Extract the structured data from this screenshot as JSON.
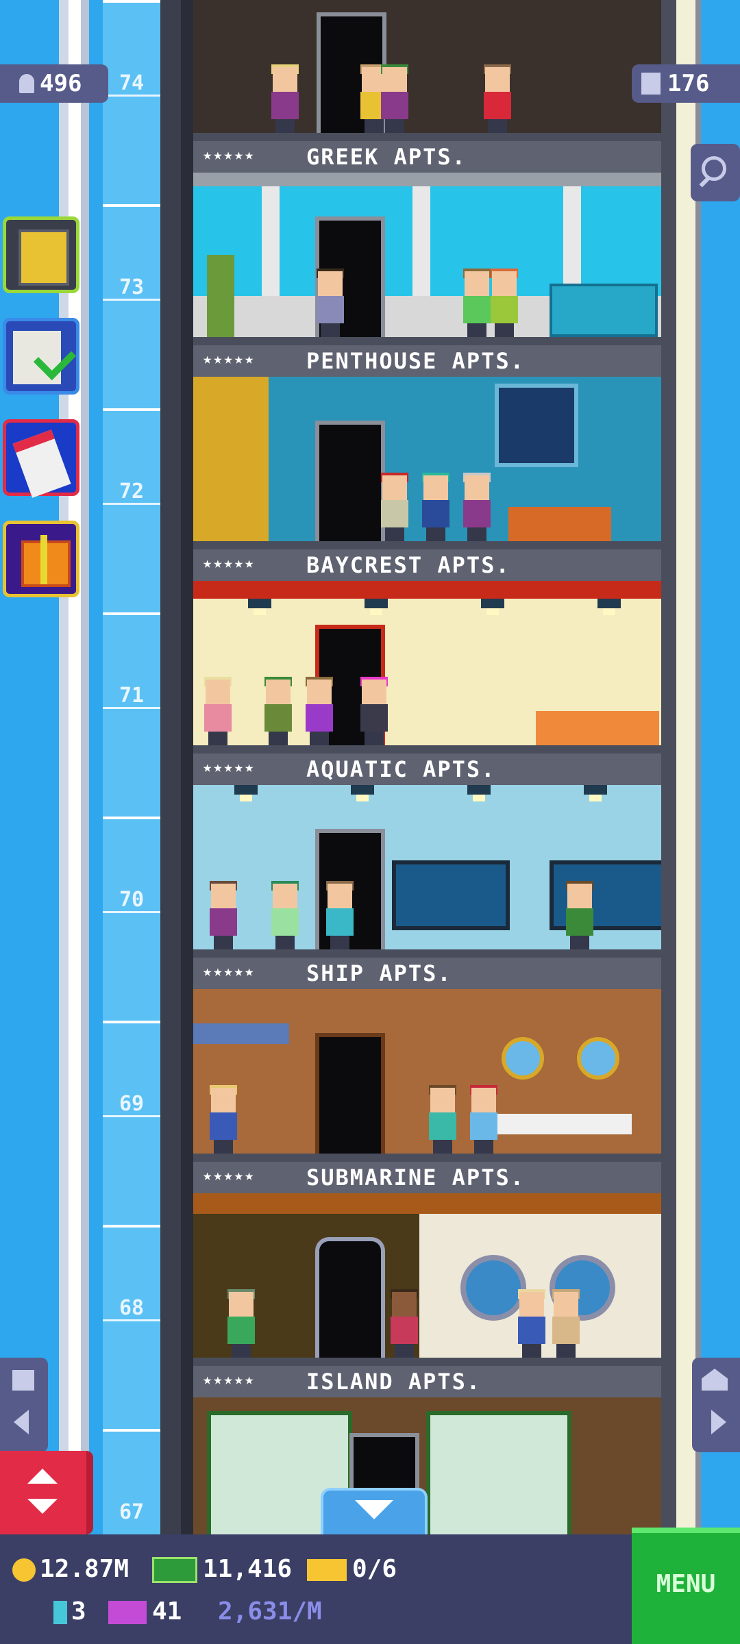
{
  "hud_top": {
    "population": "496",
    "population_icon": "person-icon",
    "floors_count": "176",
    "floors_icon": "building-icon"
  },
  "floor_numbers": [
    "74",
    "73",
    "72",
    "71",
    "70",
    "69",
    "68",
    "67"
  ],
  "floors": [
    {
      "name": "GREEK APTS.",
      "stars": "★★★★★"
    },
    {
      "name": "PENTHOUSE APTS.",
      "stars": "★★★★★"
    },
    {
      "name": "BAYCREST APTS.",
      "stars": "★★★★★"
    },
    {
      "name": "AQUATIC APTS.",
      "stars": "★★★★★"
    },
    {
      "name": "SHIP APTS.",
      "stars": "★★★★★"
    },
    {
      "name": "SUBMARINE APTS.",
      "stars": "★★★★★"
    },
    {
      "name": "ISLAND APTS.",
      "stars": "★★★★★"
    }
  ],
  "bottom_hud": {
    "coins": "12.87M",
    "bux": "11,416",
    "tickets": "0/6",
    "tower_bux": "3",
    "golden_tickets": "41",
    "income_rate": "2,631/M",
    "menu_label": "MENU"
  },
  "colors": {
    "sky": "#2ea7ee",
    "hud_bg": "#3b3f66",
    "menu_green": "#1fb23a",
    "lift_red": "#e22c47"
  }
}
